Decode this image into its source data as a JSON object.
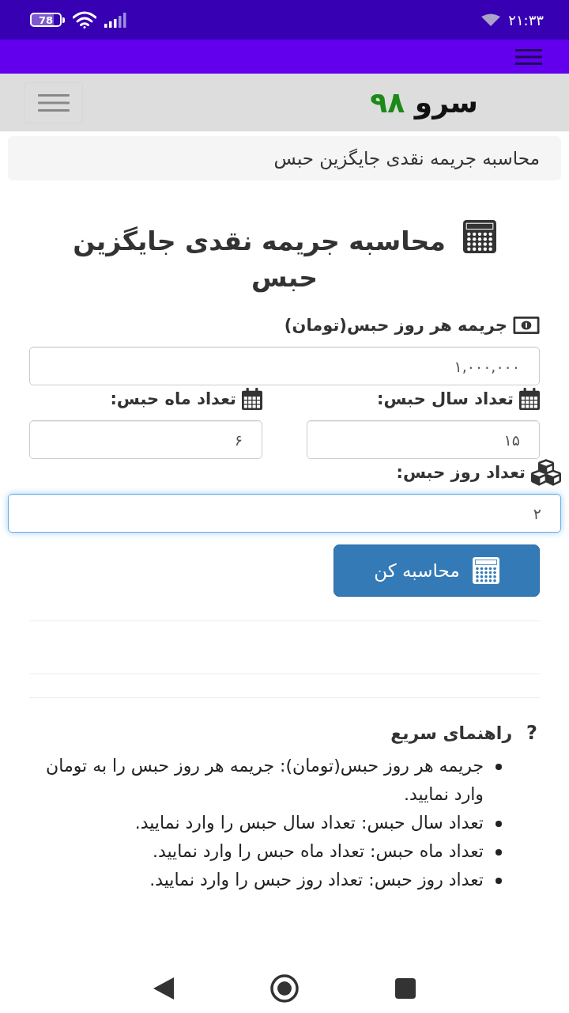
{
  "status_bar": {
    "battery": "78",
    "time": "۲۱:۳۳"
  },
  "site_header": {
    "logo_word": "سرو",
    "logo_number": "۹۸"
  },
  "breadcrumb": {
    "current": "محاسبه جریمه نقدی جایگزین حبس"
  },
  "page_title": "محاسبه جریمه نقدی جایگزین حبس",
  "form": {
    "rows": [
      {
        "fields": [
          {
            "kind": "money",
            "label": "جریمه هر روز حبس(تومان)",
            "value": "۱,۰۰۰,۰۰۰",
            "focused": false
          }
        ]
      },
      {
        "fields": [
          {
            "kind": "calendar",
            "label": "تعداد سال حبس:",
            "value": "۱۵",
            "focused": false
          },
          {
            "kind": "calendar",
            "label": "تعداد ماه حبس:",
            "value": "۶",
            "focused": false
          }
        ]
      },
      {
        "fields": [
          {
            "kind": "cubes",
            "label": "تعداد روز حبس:",
            "value": "۲",
            "focused": true
          }
        ]
      }
    ],
    "submit": {
      "label": "محاسبه کن"
    }
  },
  "help": {
    "marker": "?",
    "title": "راهنمای سریع",
    "items": [
      "جریمه هر روز حبس(تومان): جریمه هر روز حبس را به تومان وارد نمایید.",
      "تعداد سال حبس: تعداد سال حبس را وارد نمایید.",
      "تعداد ماه حبس: تعداد ماه حبس را وارد نمایید.",
      "تعداد روز حبس: تعداد روز حبس را وارد نمایید."
    ]
  }
}
